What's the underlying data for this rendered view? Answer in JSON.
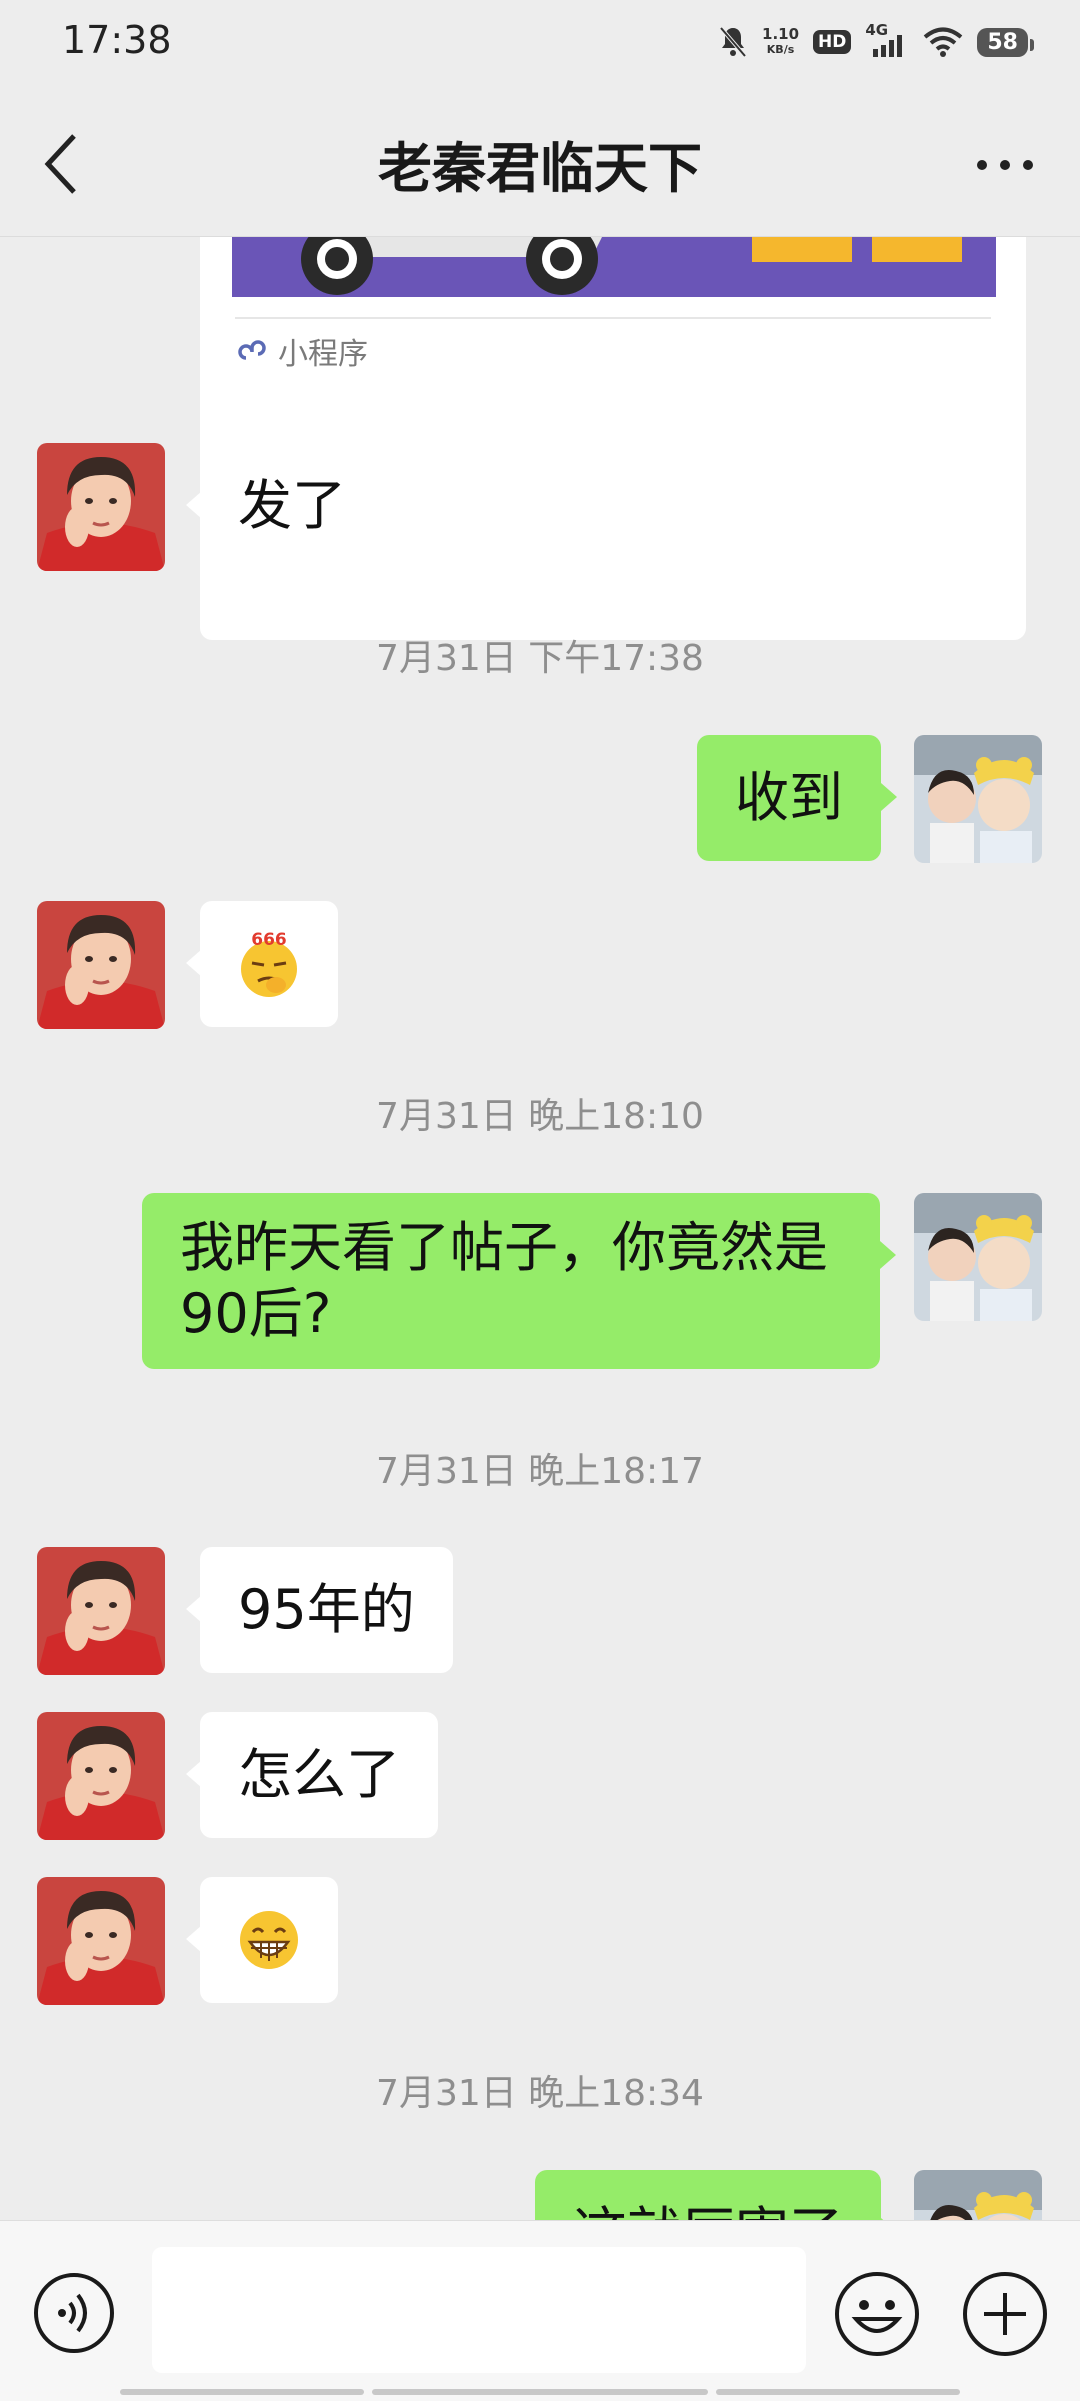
{
  "status_bar": {
    "time": "17:38",
    "net_speed_value": "1.10",
    "net_speed_unit": "KB/s",
    "hd": "HD",
    "signal": "4G",
    "battery": "58"
  },
  "header": {
    "title": "老秦君临天下"
  },
  "miniprogram_card": {
    "footer": "小程序"
  },
  "messages": [
    {
      "side": "left",
      "text": "发了"
    },
    {
      "timestamp": "7月31日 下午17:38"
    },
    {
      "side": "right",
      "text": "收到"
    },
    {
      "side": "left",
      "emoji": "666-emoji-icon",
      "emoji_text": "666"
    },
    {
      "timestamp": "7月31日 晚上18:10"
    },
    {
      "side": "right",
      "text": "我昨天看了帖子，你竟然是90后?"
    },
    {
      "timestamp": "7月31日 晚上18:17"
    },
    {
      "side": "left",
      "text": "95年的"
    },
    {
      "side": "left",
      "text": "怎么了"
    },
    {
      "side": "left",
      "emoji": "grin-emoji-icon"
    },
    {
      "timestamp": "7月31日 晚上18:34"
    },
    {
      "side": "right",
      "text": "这就厉害了",
      "partially_visible": true
    }
  ],
  "input_bar": {
    "text_value": "",
    "icons": [
      "voice-icon",
      "emoji-face-icon",
      "plus-icon"
    ]
  },
  "colors": {
    "background": "#ededed",
    "bubble_sent": "#95ec69",
    "bubble_received": "#ffffff",
    "timestamp": "#8e8e8e"
  }
}
